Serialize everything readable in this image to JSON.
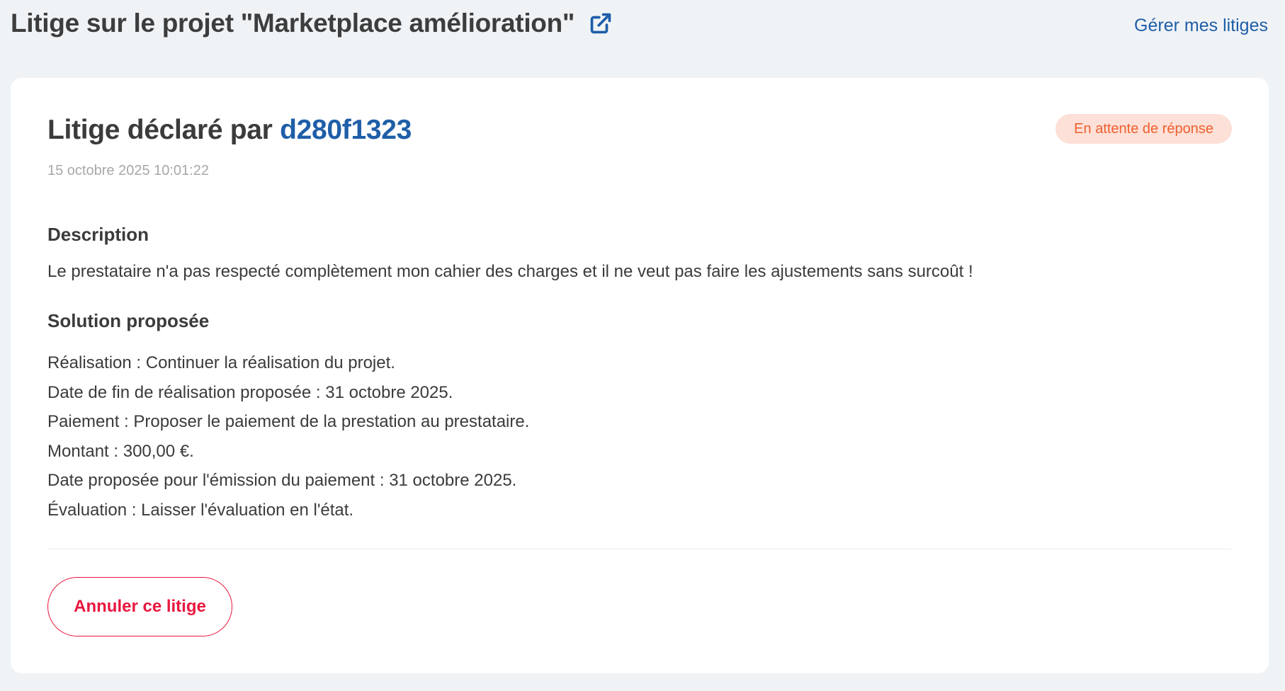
{
  "header": {
    "title": "Litige sur le projet \"Marketplace amélioration\"",
    "external_link_icon": "external-link-icon",
    "manage_link": "Gérer mes litiges"
  },
  "dispute": {
    "declared_prefix": "Litige déclaré par ",
    "declared_by": "d280f1323",
    "status": "En attente de réponse",
    "date": "15 octobre 2025 10:01:22",
    "description_heading": "Description",
    "description_text": "Le prestataire n'a pas respecté complètement mon cahier des charges et il ne veut pas faire les ajustements sans surcoût !",
    "solution_heading": "Solution proposée",
    "solution_lines": [
      "Réalisation : Continuer la réalisation du projet.",
      "Date de fin de réalisation proposée : 31 octobre 2025.",
      "Paiement : Proposer le paiement de la prestation au prestataire.",
      "Montant : 300,00 €.",
      "Date proposée pour l'émission du paiement : 31 octobre 2025.",
      "Évaluation : Laisser l'évaluation en l'état."
    ],
    "cancel_button": "Annuler ce litige"
  },
  "colors": {
    "background": "#f0f3f6",
    "link": "#1f5ea8",
    "status_text": "#ef5f2e",
    "status_background": "#fde0d7",
    "danger": "#e8173f"
  }
}
